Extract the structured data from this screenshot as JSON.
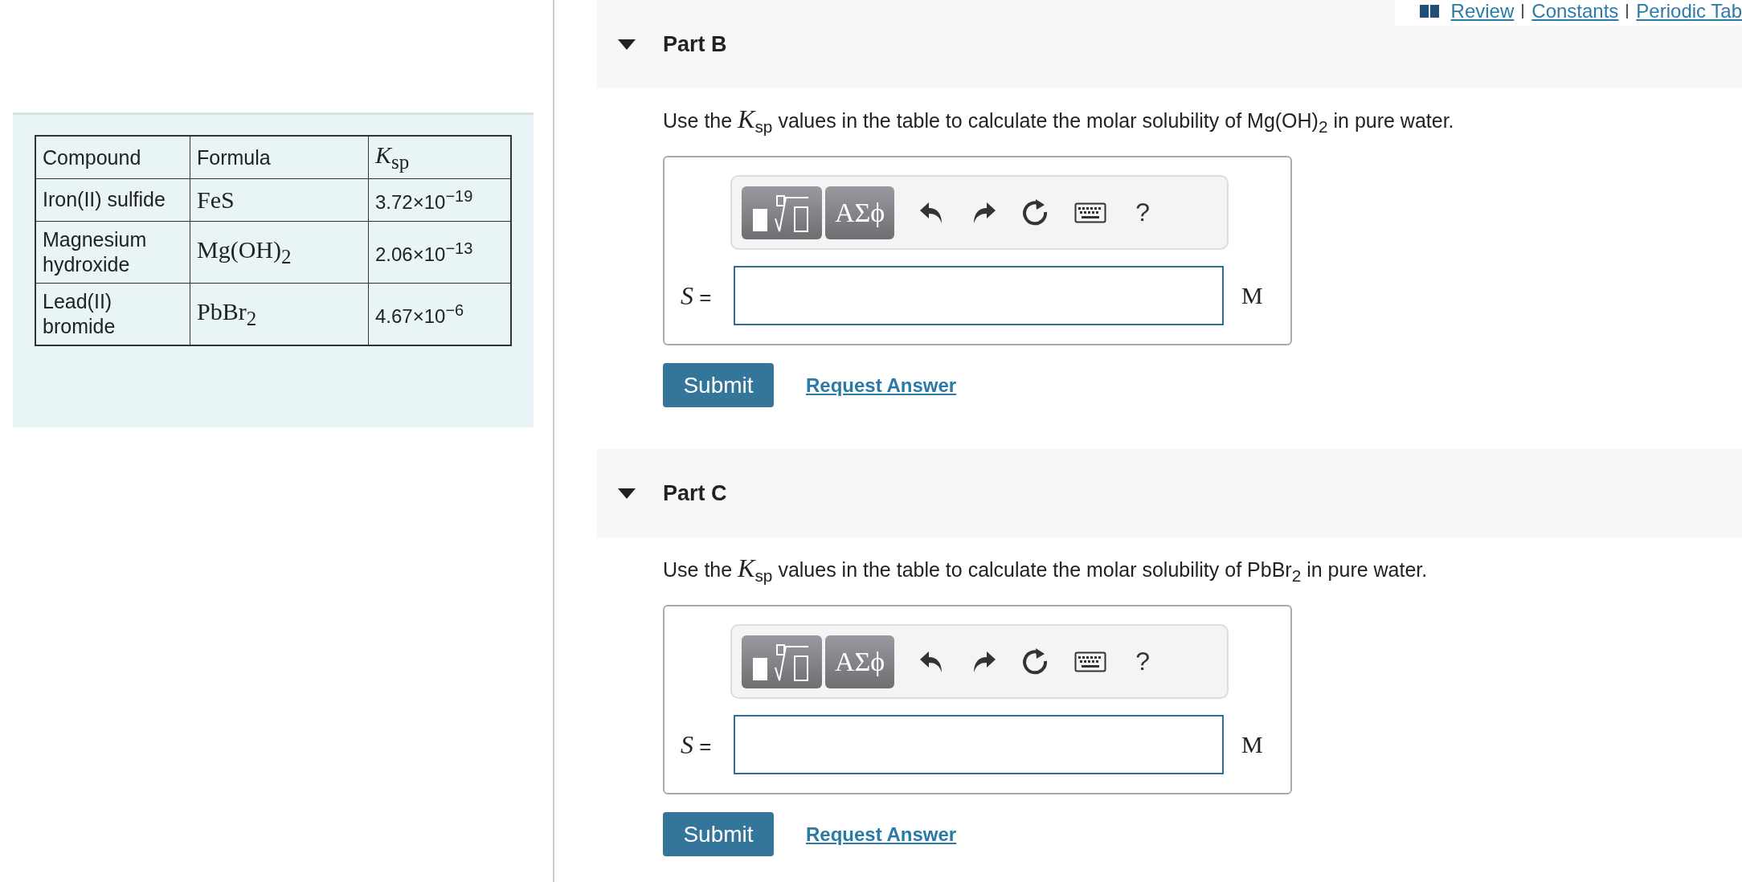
{
  "top_links": [
    "Review",
    "Constants",
    "Periodic Tab"
  ],
  "table": {
    "columns": [
      "Compound",
      "Formula",
      "*K*$_{sp}$"
    ],
    "rows": [
      [
        "Iron(II) sulfide",
        "FeS",
        "3.72×10$^{−19}$"
      ],
      [
        "Magnesium hydroxide",
        "Mg(OH)$_{2}$",
        "2.06×10$^{−13}$"
      ],
      [
        "Lead(II) bromide",
        "PbBr$_{2}$",
        "4.67×10$^{−6}$"
      ]
    ]
  },
  "parts": [
    {
      "title": "Part B",
      "expanded": true,
      "question": "Use the *K*$_{sp}$ values in the table to calculate the molar solubility of Mg(OH)$_{2}$ in pure water.",
      "greek_button": "ΑΣϕ",
      "help": "?",
      "variable": "S",
      "equals": "=",
      "unit": "M",
      "submit": "Submit",
      "request": "Request Answer"
    },
    {
      "title": "Part C",
      "expanded": true,
      "question": "Use the *K*$_{sp}$ values in the table to calculate the molar solubility of PbBr$_{2}$ in pure water.",
      "greek_button": "ΑΣϕ",
      "help": "?",
      "variable": "S",
      "equals": "=",
      "unit": "M",
      "submit": "Submit",
      "request": "Request Answer"
    }
  ]
}
